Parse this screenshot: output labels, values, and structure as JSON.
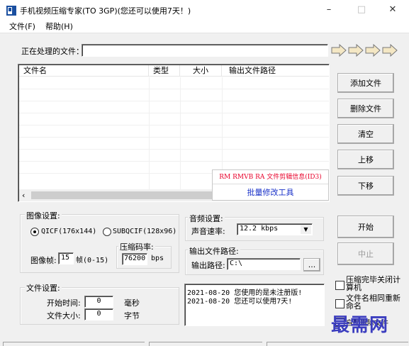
{
  "window": {
    "title": "手机视频压缩专家(TO 3GP)(您还可以使用7天！)",
    "minimize": "–",
    "maximize": "□",
    "close": "✕"
  },
  "menu": [
    "文件(F)",
    "帮助(H)"
  ],
  "processing": {
    "label": "正在处理的文件：",
    "value": ""
  },
  "file_list": {
    "columns": [
      "文件名",
      "类型",
      "大小",
      "输出文件路径"
    ],
    "rows": []
  },
  "overlay": {
    "tag_editor": "RM RMVB RA 文件剪辑信息(ID3)",
    "batch_tool": "批量修改工具"
  },
  "buttons": {
    "add": "添加文件",
    "delete": "删除文件",
    "clear": "清空",
    "move_up": "上移",
    "move_down": "下移",
    "start": "开始",
    "stop": "中止",
    "browse": "..."
  },
  "image_settings": {
    "legend": "图像设置:",
    "radio_qcif": "QICF(176x144)",
    "radio_subqcif": "SUBQCIF(128x96)",
    "qcif_selected": true,
    "frames_label": "图像帧:",
    "frames_value": "15",
    "frames_range": "帧(0-15)",
    "bitrate_legend": "压缩码率:",
    "bitrate_value": "76200",
    "bitrate_unit": "bps"
  },
  "audio_settings": {
    "legend": "音频设置:",
    "rate_label": "声音速率:",
    "rate_value": "12.2 kbps"
  },
  "output": {
    "legend": "输出文件路径:",
    "path_label": "输出路径:",
    "path_value": "C:\\"
  },
  "file_settings": {
    "legend": "文件设置:",
    "start_label": "开始时间:",
    "start_value": "0",
    "start_unit": "毫秒",
    "size_label": "文件大小:",
    "size_value": "0",
    "size_unit": "字节"
  },
  "log": [
    "2021-08-20 您使用的是未注册版!",
    "2021-08-20 您还可以使用7天!"
  ],
  "options": {
    "shutdown": "压缩完毕关闭计算机",
    "rename": "文件名相同重新命名",
    "auto": "自动删除文件"
  },
  "watermark": "最needs网",
  "colors": {
    "overlay_red": "#e8002a",
    "overlay_blue": "#1830c8",
    "watermark": "#3b3dbf",
    "arrow_fill": "#f4e7c4"
  }
}
